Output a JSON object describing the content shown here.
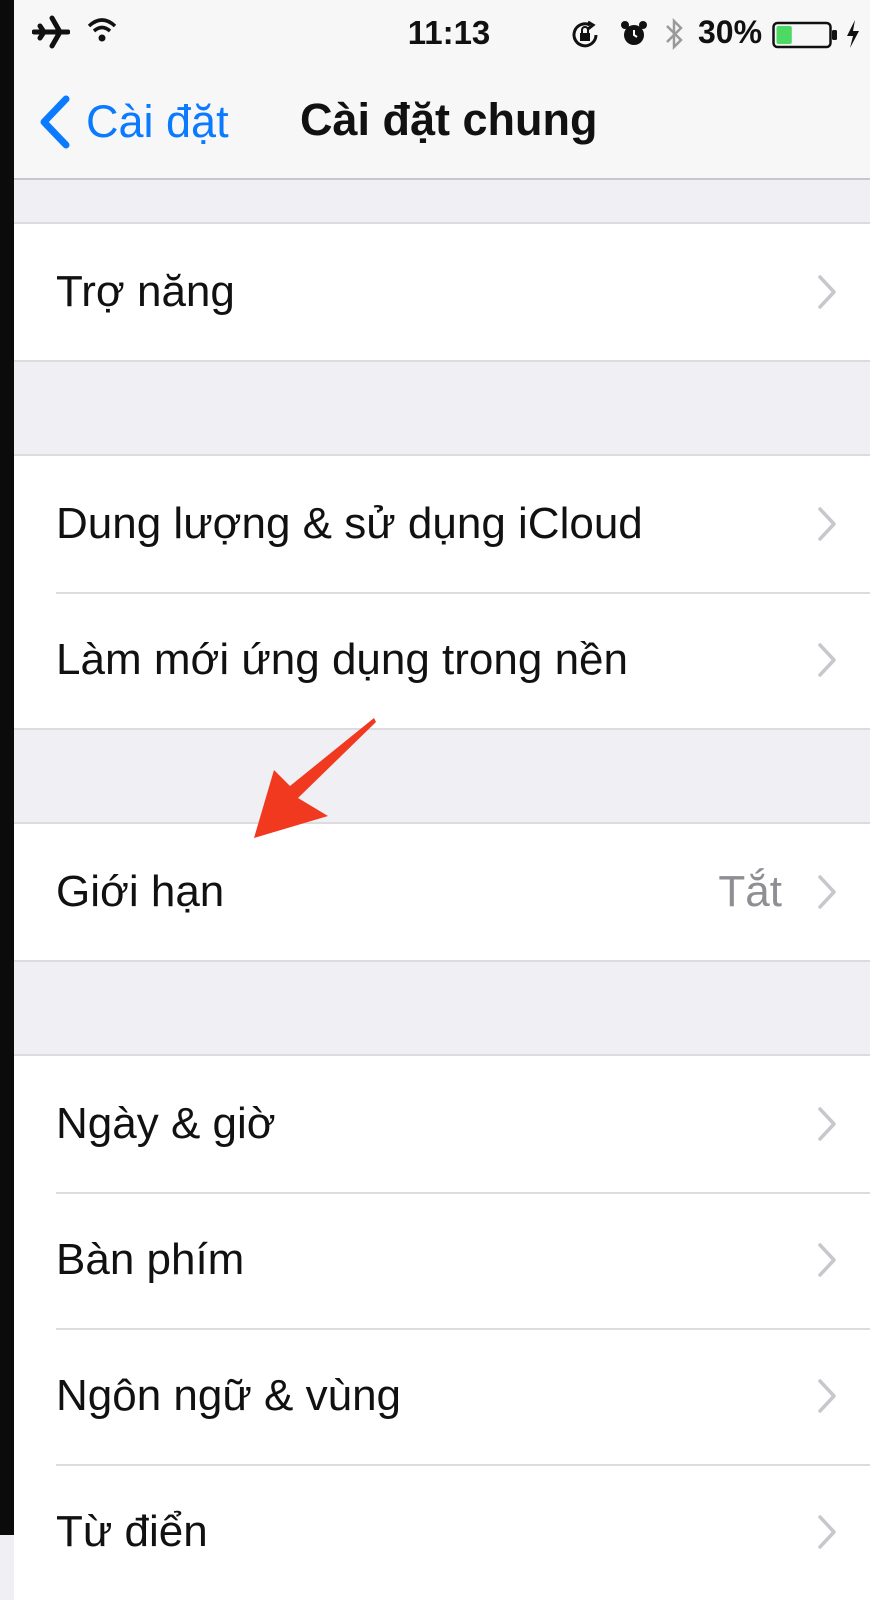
{
  "status_bar": {
    "time": "11:13",
    "battery_percent": "30%",
    "battery_level": 0.3,
    "icons": [
      "airplane-icon",
      "wifi-icon",
      "rotation-lock-icon",
      "alarm-icon",
      "bluetooth-icon",
      "battery-icon",
      "charging-icon"
    ]
  },
  "nav": {
    "back_label": "Cài đặt",
    "title": "Cài đặt chung"
  },
  "groups": [
    {
      "rows": [
        {
          "label": "Trợ năng",
          "value": ""
        }
      ]
    },
    {
      "rows": [
        {
          "label": "Dung lượng & sử dụng iCloud",
          "value": ""
        },
        {
          "label": "Làm mới ứng dụng trong nền",
          "value": ""
        }
      ]
    },
    {
      "rows": [
        {
          "label": "Giới hạn",
          "value": "Tắt"
        }
      ]
    },
    {
      "rows": [
        {
          "label": "Ngày & giờ",
          "value": ""
        },
        {
          "label": "Bàn phím",
          "value": ""
        },
        {
          "label": "Ngôn ngữ & vùng",
          "value": ""
        },
        {
          "label": "Từ điển",
          "value": ""
        }
      ]
    }
  ],
  "colors": {
    "accent": "#0a7aff",
    "background": "#efeff4",
    "annotation_arrow": "#f0391e"
  }
}
